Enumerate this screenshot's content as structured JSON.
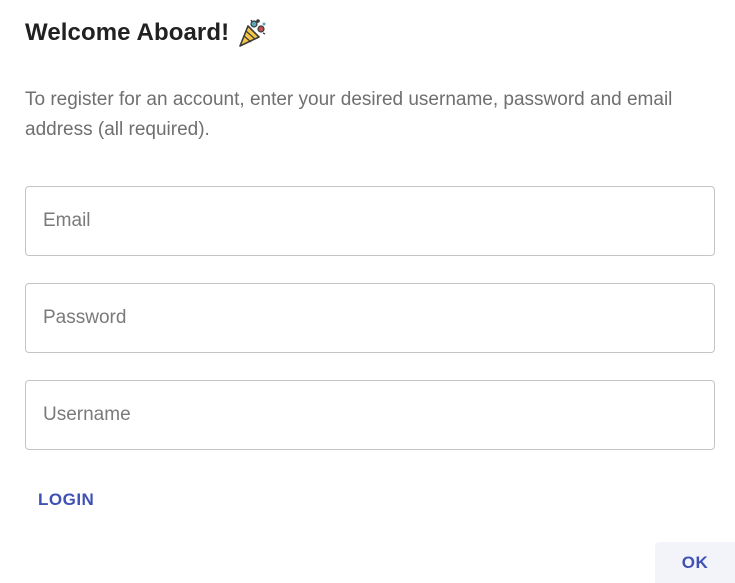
{
  "dialog": {
    "title": "Welcome Aboard!",
    "title_icon": "party-popper-icon",
    "intro_text": "To register for an account, enter your desired username, password and email address (all required)."
  },
  "form": {
    "email": {
      "placeholder": "Email",
      "value": ""
    },
    "password": {
      "placeholder": "Password",
      "value": ""
    },
    "username": {
      "placeholder": "Username",
      "value": ""
    }
  },
  "actions": {
    "login_label": "LOGIN",
    "ok_label": "OK"
  },
  "colors": {
    "accent": "#3f51b5",
    "title_text": "#212121",
    "body_text": "#6f6f6f",
    "field_border": "#c4c4c4",
    "ok_button_bg": "#f3f4f9"
  }
}
